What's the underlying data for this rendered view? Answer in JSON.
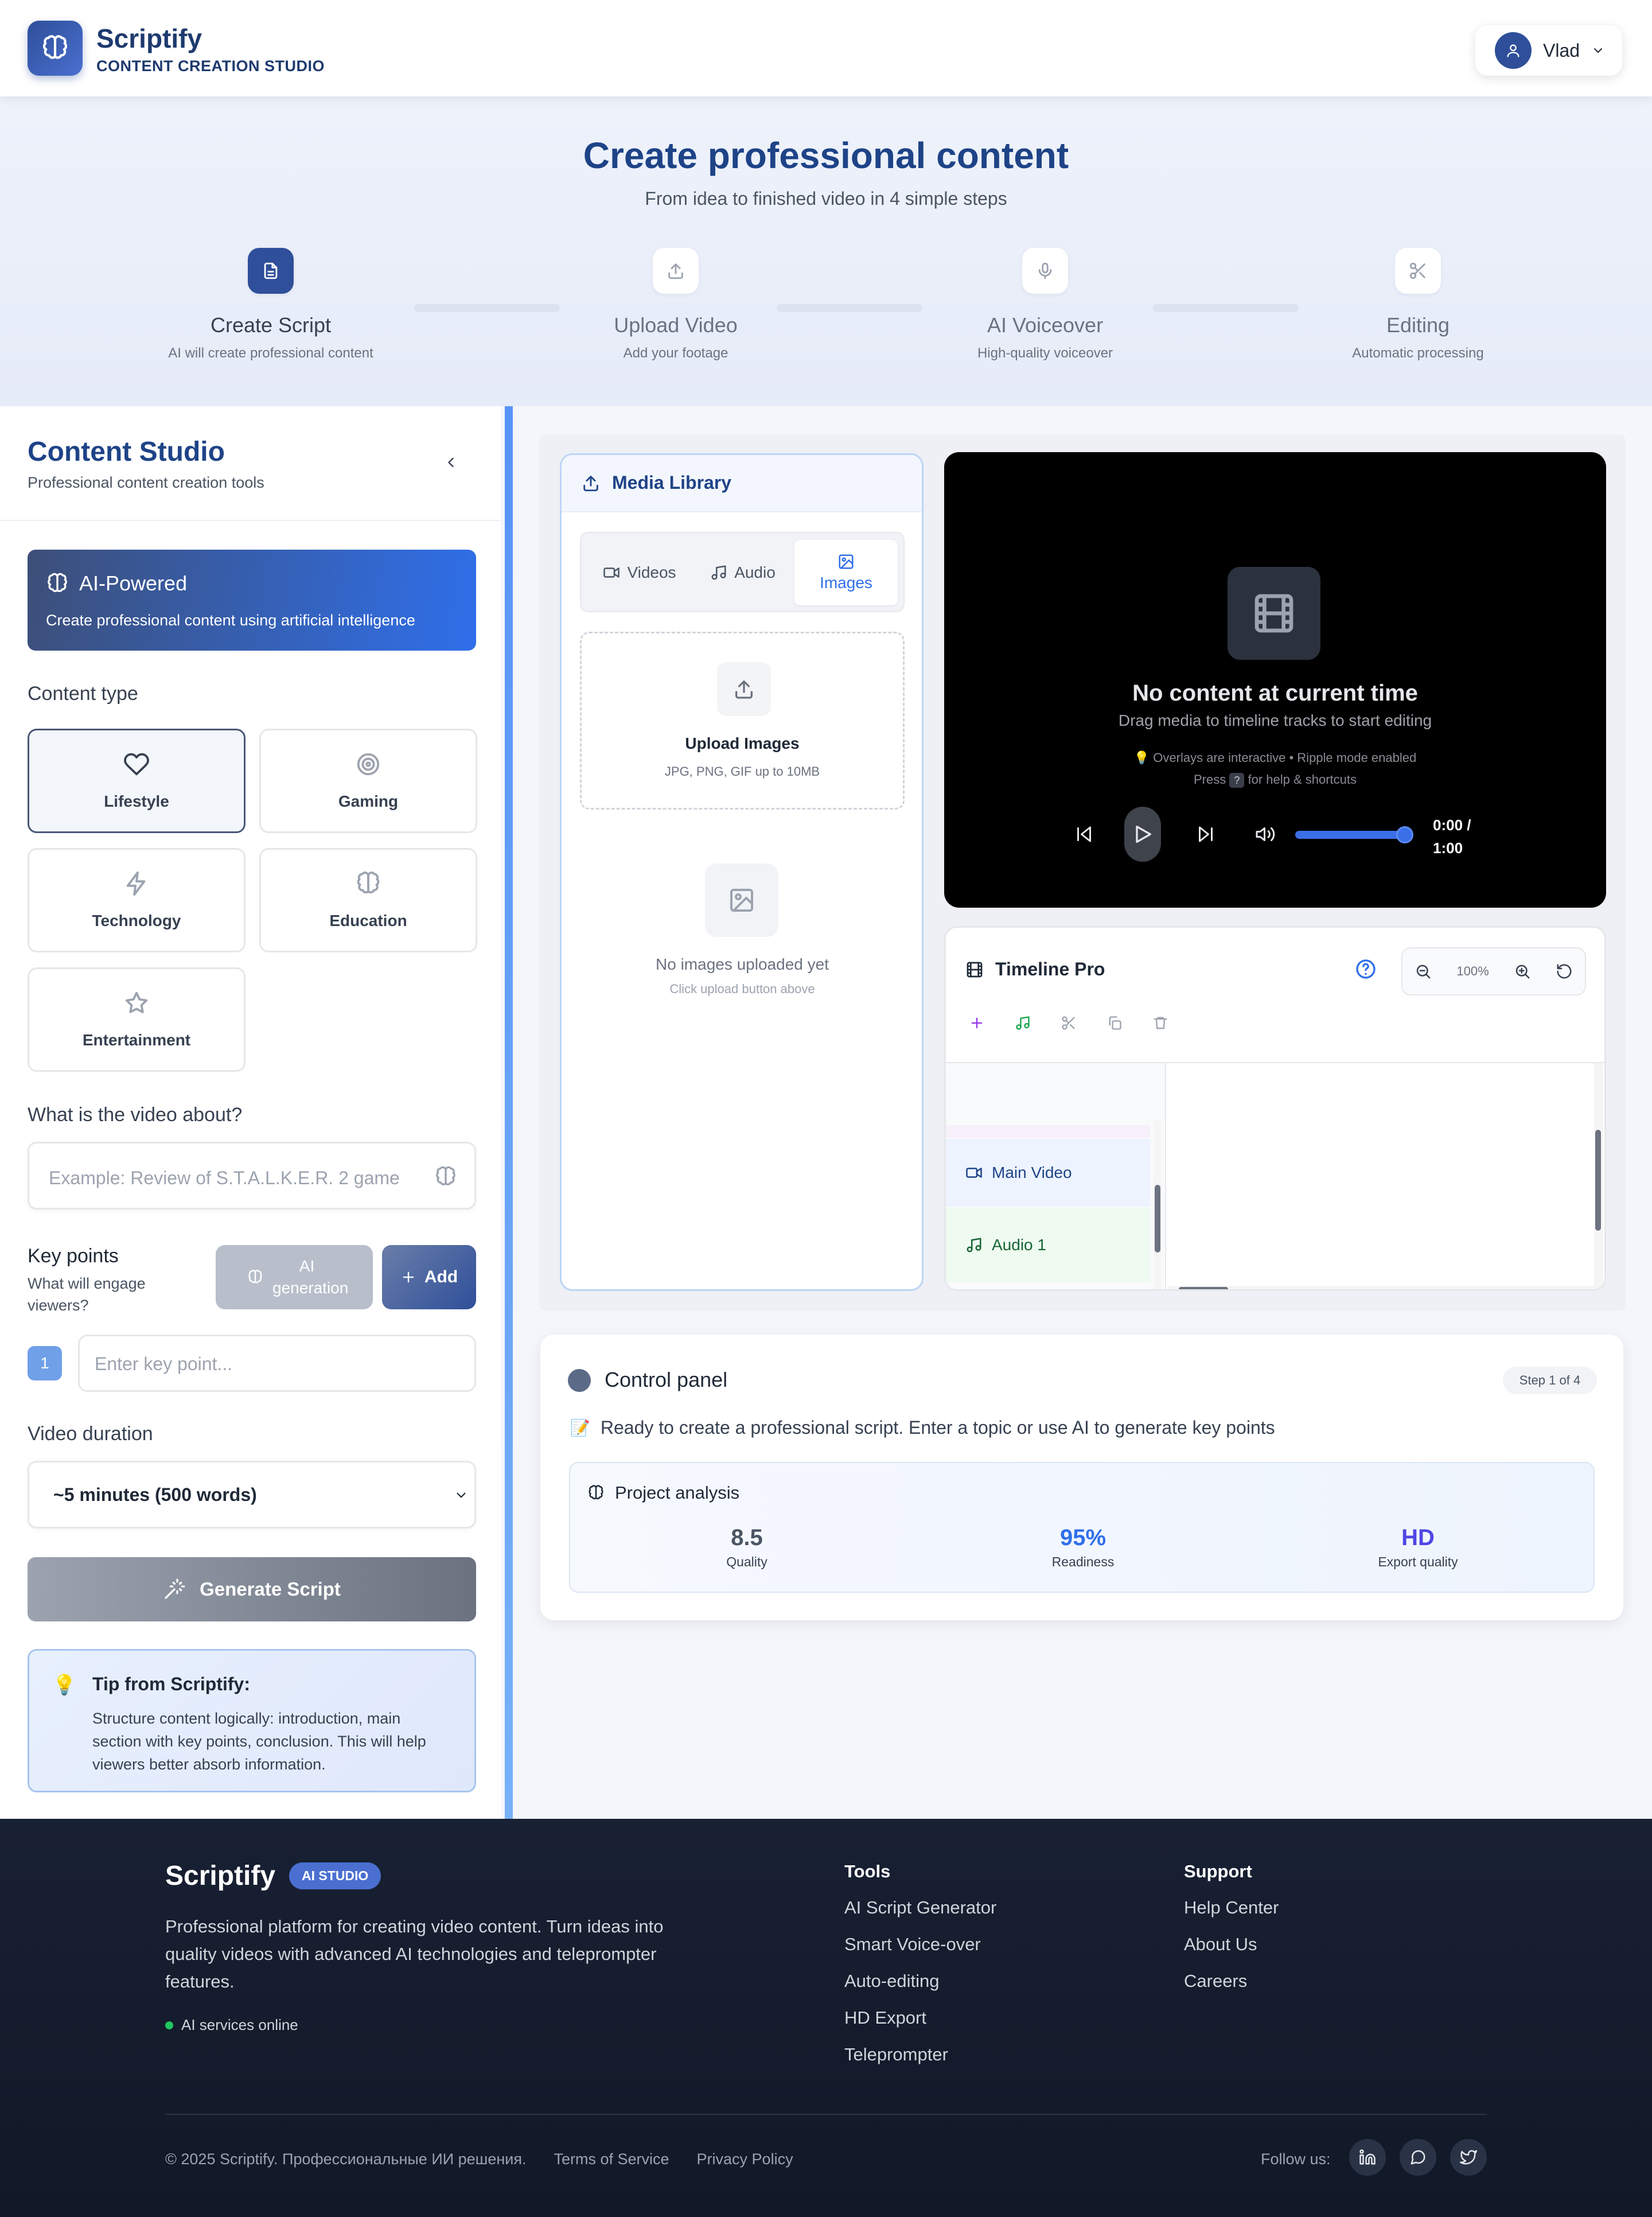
{
  "header": {
    "brand": "Scriptify",
    "subtitle": "CONTENT CREATION STUDIO",
    "user_name": "Vlad"
  },
  "hero": {
    "title": "Create professional content",
    "subtitle": "From idea to finished video in 4 simple steps",
    "steps": [
      {
        "title": "Create Script",
        "desc": "AI will create professional content",
        "icon": "document-icon",
        "active": true
      },
      {
        "title": "Upload Video",
        "desc": "Add your footage",
        "icon": "upload-icon",
        "active": false
      },
      {
        "title": "AI Voiceover",
        "desc": "High-quality voiceover",
        "icon": "microphone-icon",
        "active": false
      },
      {
        "title": "Editing",
        "desc": "Automatic processing",
        "icon": "scissors-icon",
        "active": false
      }
    ]
  },
  "studio": {
    "title": "Content Studio",
    "subtitle": "Professional content creation tools",
    "ai_title": "AI-Powered",
    "ai_desc": "Create professional content using artificial intelligence",
    "content_type_label": "Content type",
    "content_types": [
      "Lifestyle",
      "Gaming",
      "Technology",
      "Education",
      "Entertainment"
    ],
    "selected_type": "Lifestyle",
    "topic_label": "What is the video about?",
    "topic_placeholder": "Example: Review of S.T.A.L.K.E.R. 2 game",
    "key_points_label": "Key points",
    "key_points_hint": "What will engage viewers?",
    "ai_generation": "AI generation",
    "add": "Add",
    "key_point_number": "1",
    "key_point_placeholder": "Enter key point...",
    "duration_label": "Video duration",
    "duration_value": "~5 minutes (500 words)",
    "generate": "Generate Script",
    "tip_title": "Tip from Scriptify:",
    "tip_text": "Structure content logically: introduction, main section with key points, conclusion. This will help viewers better absorb information."
  },
  "media": {
    "title": "Media Library",
    "tabs": [
      "Videos",
      "Audio",
      "Images"
    ],
    "active_tab": "Images",
    "upload_title": "Upload Images",
    "upload_hint": "JPG, PNG, GIF up to 10MB",
    "empty_title": "No images uploaded yet",
    "empty_hint": "Click upload button above"
  },
  "player": {
    "no_content": "No content at current time",
    "hint": "Drag media to timeline tracks to start editing",
    "overlay_note": "Overlays are interactive • Ripple mode enabled",
    "press": "Press",
    "key": "?",
    "help": "for help & shortcuts",
    "time_current": "0:00 /",
    "time_total": "1:00",
    "volume": 0.85
  },
  "timeline": {
    "title": "Timeline Pro",
    "zoom": "100%",
    "tracks": [
      "Main Video",
      "Audio 1"
    ]
  },
  "control": {
    "title": "Control panel",
    "step": "Step 1 of 4",
    "message": "Ready to create a professional script. Enter a topic or use AI to generate key points",
    "analysis_title": "Project analysis",
    "metrics": [
      {
        "value": "8.5",
        "label": "Quality",
        "color": "#4b5563"
      },
      {
        "value": "95%",
        "label": "Readiness",
        "color": "#2f6fea"
      },
      {
        "value": "HD",
        "label": "Export quality",
        "color": "#4f46e5"
      }
    ]
  },
  "footer": {
    "brand": "Scriptify",
    "badge": "AI STUDIO",
    "desc": "Professional platform for creating video content. Turn ideas into quality videos with advanced AI technologies and teleprompter features.",
    "status": "AI services online",
    "tools_title": "Tools",
    "tools": [
      "AI Script Generator",
      "Smart Voice-over",
      "Auto-editing",
      "HD Export",
      "Teleprompter"
    ],
    "support_title": "Support",
    "support": [
      "Help Center",
      "About Us",
      "Careers"
    ],
    "copyright": "© 2025 Scriptify. Профессиональные ИИ решения.",
    "terms": "Terms of Service",
    "privacy": "Privacy Policy",
    "follow": "Follow us:"
  }
}
